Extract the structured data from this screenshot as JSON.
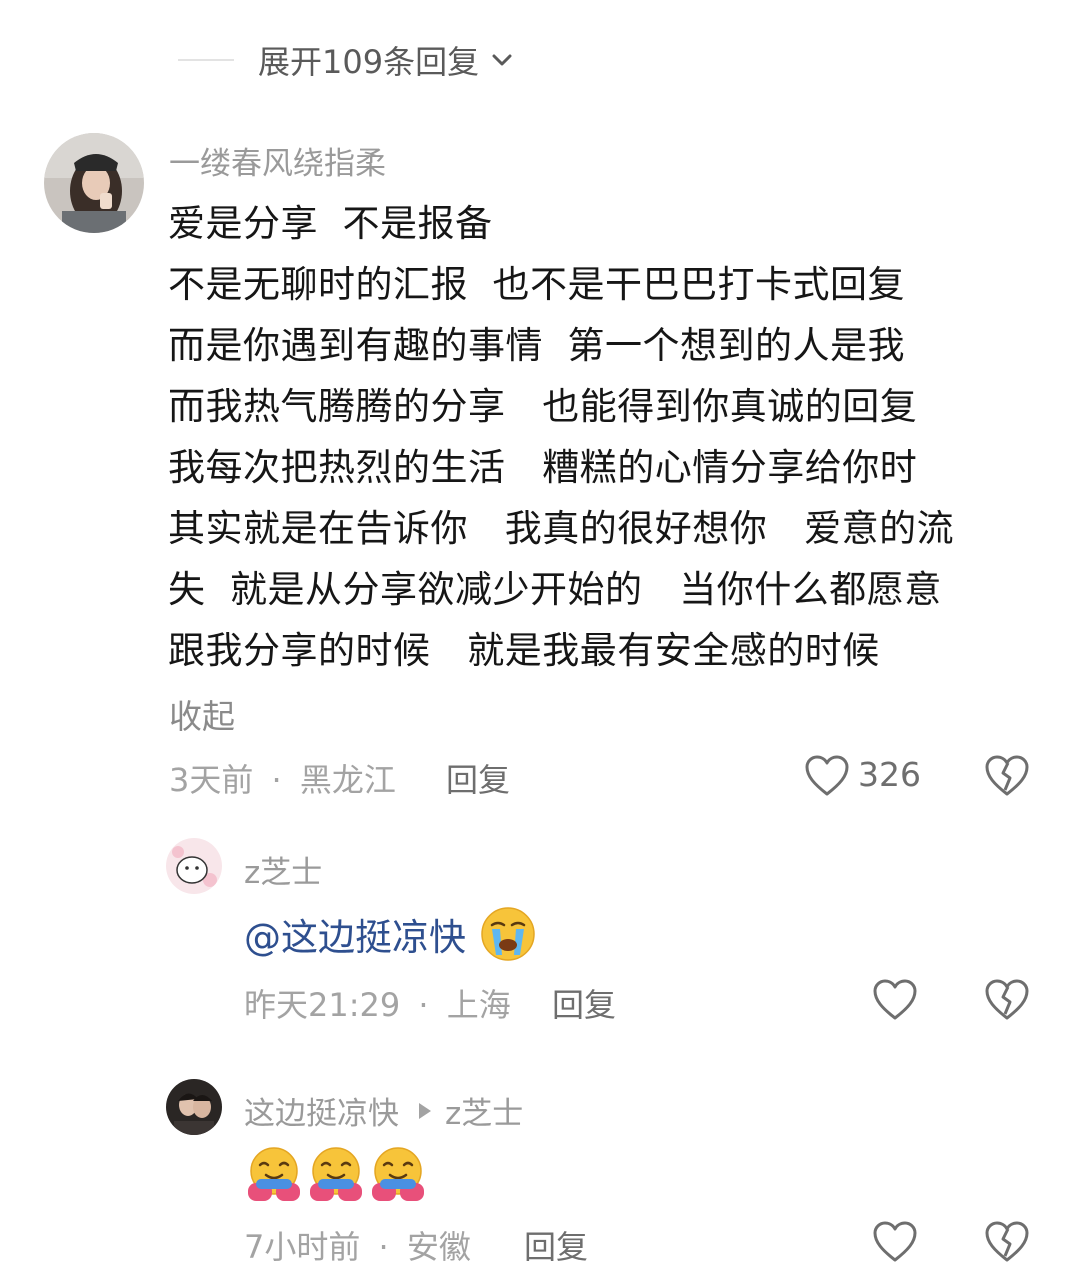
{
  "expand_replies": {
    "label": "展开109条回复"
  },
  "main_comment": {
    "username": "一缕春风绕指柔",
    "lines": [
      "爱是分享  不是报备",
      "不是无聊时的汇报  也不是干巴巴打卡式回复",
      "而是你遇到有趣的事情  第一个想到的人是我",
      "而我热气腾腾的分享   也能得到你真诚的回复",
      "我每次把热烈的生活   糟糕的心情分享给你时",
      "其实就是在告诉你   我真的很好想你   爱意的流",
      "失  就是从分享欲减少开始的   当你什么都愿意",
      "跟我分享的时候   就是我最有安全感的时候"
    ],
    "collapse_label": "收起",
    "time": "3天前",
    "location": "黑龙江",
    "reply_label": "回复",
    "like_count": "326"
  },
  "reply_1": {
    "username": "z芝士",
    "mention": "@这边挺凉快",
    "emoji": "crying-face",
    "time": "昨天21:29",
    "location": "上海",
    "reply_label": "回复"
  },
  "reply_2": {
    "username": "这边挺凉快",
    "reply_to": "z芝士",
    "emojis": [
      "hugging-face",
      "hugging-face",
      "hugging-face"
    ],
    "time": "7小时前",
    "location": "安徽",
    "reply_label": "回复"
  },
  "separator": "·",
  "colors": {
    "mention": "#2e4f8f",
    "meta": "#a3a3a3",
    "text": "#161616"
  }
}
